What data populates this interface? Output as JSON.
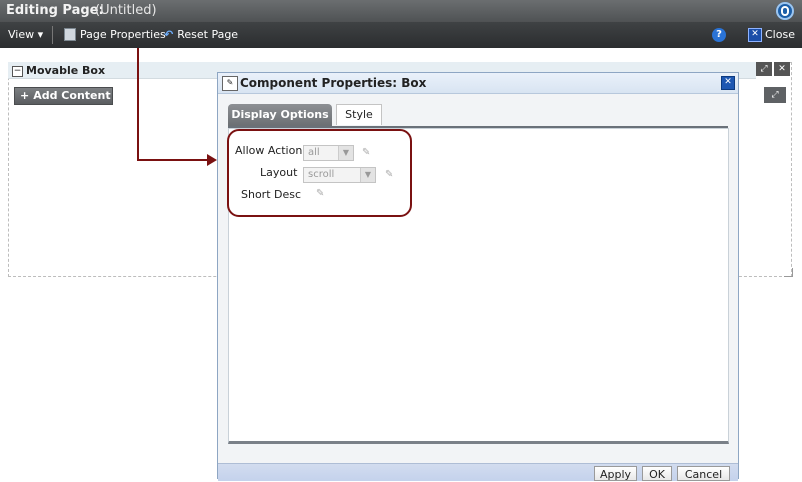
{
  "titlebar": {
    "title": "Editing Page:",
    "subtitle": "(Untitled)",
    "logo": "oracle-logo-icon"
  },
  "toolbar": {
    "view_label": "View",
    "page_properties_label": "Page Properties",
    "reset_page_label": "Reset Page",
    "help_glyph": "?",
    "close_label": "Close"
  },
  "movable_box": {
    "title": "Movable Box",
    "add_content_label": "Add Content",
    "add_glyph": "+"
  },
  "dialog": {
    "title": "Component Properties: Box",
    "tabs": [
      {
        "label": "Display Options",
        "active": true
      },
      {
        "label": "Style",
        "active": false
      }
    ],
    "fields": [
      {
        "label": "Allow Action",
        "value": "all"
      },
      {
        "label": "Layout",
        "value": "scroll"
      },
      {
        "label": "Short Desc",
        "value": ""
      }
    ],
    "buttons": {
      "apply": "Apply",
      "ok": "OK",
      "cancel": "Cancel"
    }
  },
  "colors": {
    "highlight": "#7a1111",
    "toolbar": "#2b2d2f",
    "accent": "#1d57b2"
  }
}
